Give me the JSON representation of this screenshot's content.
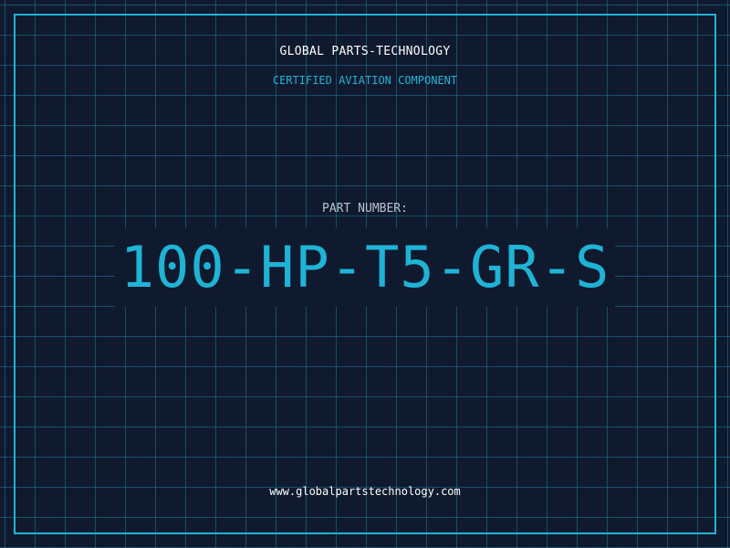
{
  "header": {
    "company_name": "GLOBAL PARTS-TECHNOLOGY",
    "subtitle": "CERTIFIED AVIATION COMPONENT"
  },
  "part": {
    "label": "PART NUMBER:",
    "number": "100-HP-T5-GR-S"
  },
  "footer": {
    "website": "www.globalpartstechnology.com"
  },
  "colors": {
    "background": "#0f1a2e",
    "accent": "#1fb3d6",
    "text_primary": "#ffffff",
    "text_muted": "#b9c3d0"
  }
}
